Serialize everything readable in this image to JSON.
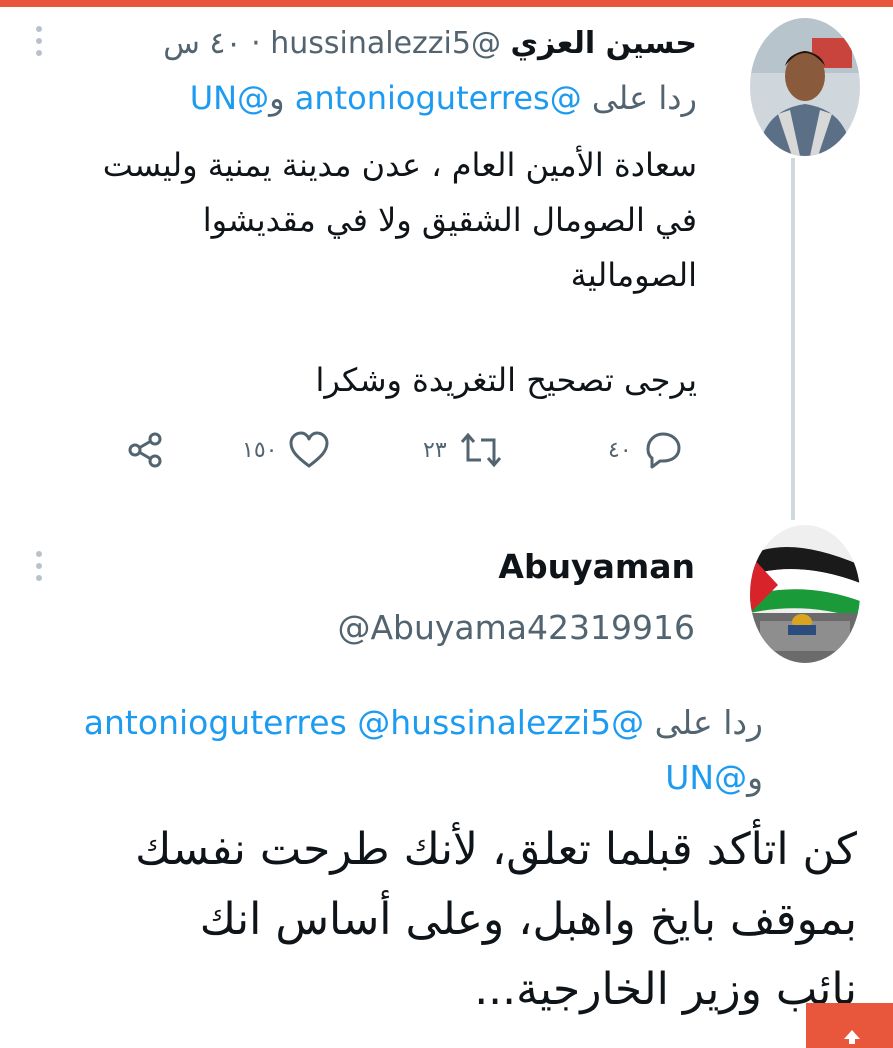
{
  "colors": {
    "top_bar": "#e8563c",
    "link": "#1d9bf0",
    "secondary_text": "#536471",
    "scroll_button": "#e8563c"
  },
  "tweet1": {
    "name": "حسين العزي",
    "handle": "@hussinalezzi5",
    "separator": "·",
    "time": "٤٠ س",
    "reply_prefix": "ردا على",
    "reply_mention1": "@antonioguterres",
    "reply_conjunction": "و",
    "reply_mention2": "@UN",
    "body_line1": "سعادة الأمين العام ، عدن مدينة يمنية وليست",
    "body_line2": "في الصومال الشقيق ولا في مقديشوا",
    "body_line3": "الصومالية",
    "body_line4": "يرجى  تصحيح التغريدة وشكرا",
    "replies_count": "٤٠",
    "retweets_count": "٢٣",
    "likes_count": "١٥٠",
    "icons": [
      "more-dots-icon",
      "reply-icon",
      "retweet-icon",
      "like-icon",
      "share-icon"
    ]
  },
  "tweet2": {
    "name": "Abuyaman",
    "handle": "@Abuyama42319916",
    "reply_prefix": "ردا على",
    "reply_mention1": "@antonioguterres",
    "reply_mention2": "@hussinalezzi5",
    "reply_conjunction": "و",
    "reply_mention3": "@UN",
    "body_line1": "كن اتأكد قبلما تعلق،  لأنك طرحت نفسك",
    "body_line2": "بموقف بايخ واهبل، وعلى أساس انك",
    "body_line3": "نائب وزير الخارجية..."
  },
  "scroll_top": {
    "icon": "arrow-up-icon"
  }
}
